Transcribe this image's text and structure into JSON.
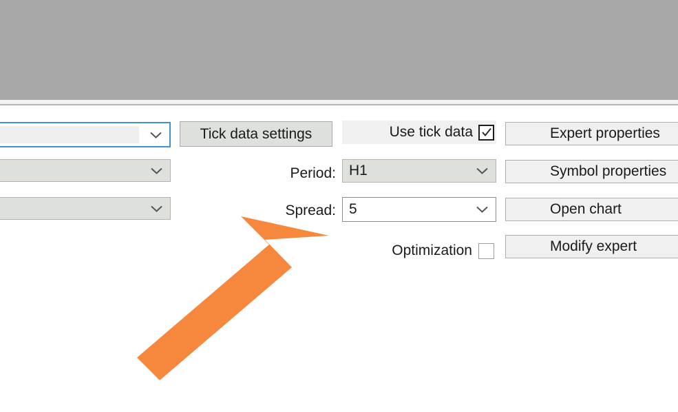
{
  "window": {
    "top_panel_color": "#a8a8a8",
    "background_color": "#ffffff"
  },
  "left_column": {
    "symbol_combo": {
      "value": "",
      "arrow_icon": "chevron-down-icon",
      "focused": true
    },
    "model_combo": {
      "value": "",
      "arrow_icon": "chevron-down-icon"
    },
    "date_combo": {
      "value": "",
      "arrow_icon": "chevron-down-icon"
    }
  },
  "middle_column": {
    "tick_data_settings_label": "Tick data settings",
    "use_tick_data": {
      "label": "Use tick data",
      "checked": true,
      "check_icon": "checkmark-icon"
    },
    "period": {
      "label": "Period:",
      "value": "H1",
      "arrow_icon": "chevron-down-icon"
    },
    "spread": {
      "label": "Spread:",
      "value": "5",
      "arrow_icon": "chevron-down-icon"
    },
    "optimization": {
      "label": "Optimization",
      "checked": false
    }
  },
  "right_buttons": {
    "expert_properties": "Expert properties",
    "symbol_properties": "Symbol properties",
    "open_chart": "Open chart",
    "modify_expert": "Modify expert"
  },
  "annotation": {
    "arrow_icon": "arrow-up-right-icon",
    "color": "#F5883C",
    "points_at": "Spread: 5"
  }
}
